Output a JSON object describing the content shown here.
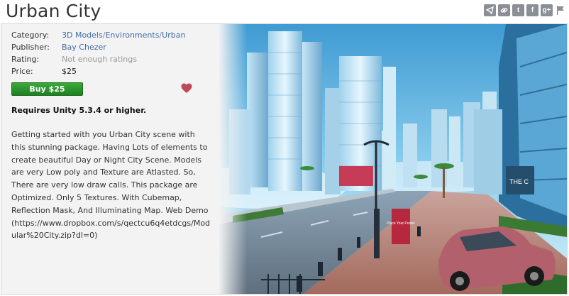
{
  "title": "Urban City",
  "share_icons": [
    {
      "name": "share-icon"
    },
    {
      "name": "link-icon"
    },
    {
      "name": "twitter-icon",
      "glyph": "t"
    },
    {
      "name": "facebook-icon",
      "glyph": "f"
    },
    {
      "name": "google-plus-icon",
      "glyph": "g+"
    },
    {
      "name": "flag-icon"
    }
  ],
  "details": {
    "category_label": "Category:",
    "category_path": [
      "3D Models",
      "Environments",
      "Urban"
    ],
    "category_sep": "/",
    "publisher_label": "Publisher:",
    "publisher": "Bay Chezer",
    "rating_label": "Rating:",
    "rating": "Not enough ratings",
    "price_label": "Price:",
    "price": "$25"
  },
  "buy_label": "Buy $25",
  "requirement": "Requires Unity 5.3.4 or higher.",
  "description": "Getting started with you Urban City scene with this stunning package. Having Lots of elements to create beautiful Day or Night City Scene. Models are very Low poly and Texture are Atlasted. So, There are very low draw calls. This package are Optimized. Only 5 Textures. With Cubemap, Reflection Mask, And Illuminating Map. Web Demo (https://www.dropbox.com/s/qectcu6q4etdcgs/Modular%20City.zip?dl=0)",
  "hero": {
    "sign_text": "Place Your Poster",
    "billboard_text": "THE C"
  },
  "colors": {
    "buy_button": "#2e9630",
    "link": "#3e6da5",
    "heart": "#c0485a",
    "sky": "#5fb2dd"
  }
}
